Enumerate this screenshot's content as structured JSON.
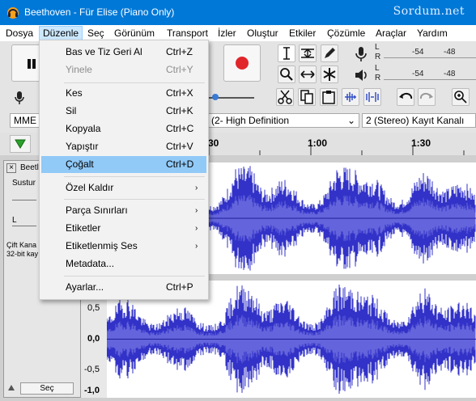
{
  "window": {
    "title": "Beethoven - Für Elise (Piano Only)",
    "watermark": "Sordum.net"
  },
  "menubar": [
    "Dosya",
    "Düzenle",
    "Seç",
    "Görünüm",
    "Transport",
    "İzler",
    "Oluştur",
    "Etkiler",
    "Çözümle",
    "Araçlar",
    "Yardım"
  ],
  "edit_menu": {
    "items": [
      {
        "label": "Bas ve Tiz Geri Al",
        "shortcut": "Ctrl+Z"
      },
      {
        "label": "Yinele",
        "shortcut": "Ctrl+Y"
      },
      {
        "label": "Kes",
        "shortcut": "Ctrl+X"
      },
      {
        "label": "Sil",
        "shortcut": "Ctrl+K"
      },
      {
        "label": "Kopyala",
        "shortcut": "Ctrl+C"
      },
      {
        "label": "Yapıştır",
        "shortcut": "Ctrl+V"
      },
      {
        "label": "Çoğalt",
        "shortcut": "Ctrl+D"
      },
      {
        "label": "Özel Kaldır",
        "arrow": "›"
      },
      {
        "label": "Parça Sınırları",
        "arrow": "›"
      },
      {
        "label": "Etiketler",
        "arrow": "›"
      },
      {
        "label": "Etiketlenmiş Ses",
        "arrow": "›"
      },
      {
        "label": "Metadata..."
      },
      {
        "label": "Ayarlar...",
        "shortcut": "Ctrl+P"
      }
    ]
  },
  "meters": {
    "L": "L",
    "R": "R",
    "tick1": "-54",
    "tick2": "-48"
  },
  "devices": {
    "host": "MME",
    "quality": "(2- High Definition",
    "channels": "2 (Stereo) Kayıt Kanalı"
  },
  "timeline": {
    "t1": "30",
    "t2": "1:00",
    "t3": "1:30"
  },
  "track": {
    "name": "Beetl",
    "mute_label": "Sustur",
    "pan_label": "L",
    "info1": "Çift Kana",
    "info2": "32-bit kay",
    "select_button": "Seç"
  },
  "yaxis": [
    "0,5",
    "0,0",
    "-0,5",
    "-1,0"
  ]
}
